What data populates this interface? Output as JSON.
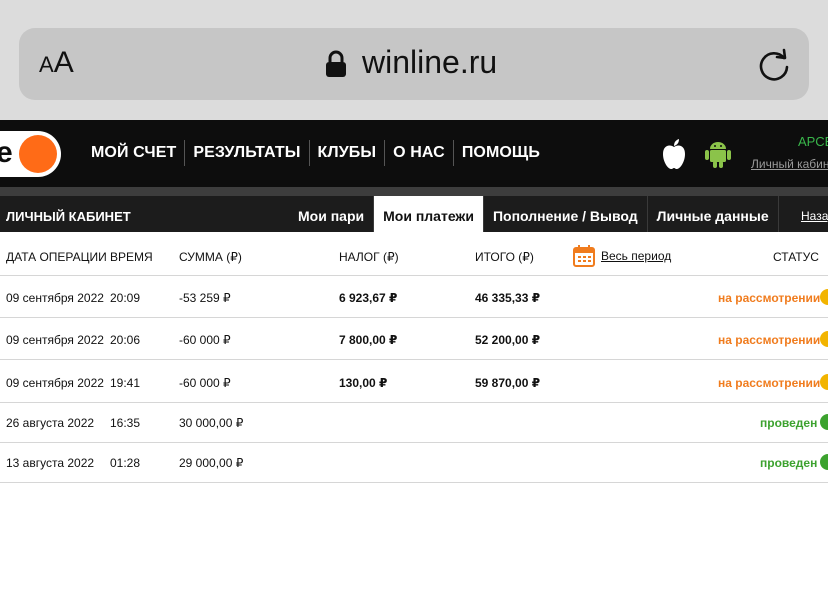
{
  "browser": {
    "aa_small": "A",
    "aa_big": "A",
    "url": "winline.ru"
  },
  "nav": {
    "logo_letter": "e",
    "menu": [
      "МОЙ СЧЕТ",
      "РЕЗУЛЬТАТЫ",
      "КЛУБЫ",
      "О НАС",
      "ПОМОЩЬ"
    ],
    "account_name": "АРСЕ",
    "account_link": "Личный кабинет"
  },
  "subnav": {
    "title": "ЛИЧНЫЙ КАБИНЕТ",
    "tabs": [
      "Мои пари",
      "Мои платежи",
      "Пополнение / Вывод",
      "Личные данные"
    ],
    "active_tab": 1,
    "back": "Назад"
  },
  "table": {
    "headers": {
      "date": "ДАТА ОПЕРАЦИИ",
      "time": "ВРЕМЯ",
      "sum": "СУММА (₽)",
      "tax": "НАЛОГ (₽)",
      "total": "ИТОГО (₽)",
      "period": "Весь период",
      "status": "СТАТУС"
    },
    "rows": [
      {
        "date": "09 сентября 2022",
        "time": "20:09",
        "sum": "-53 259 ₽",
        "tax": "6 923,67 ₽",
        "total": "46 335,33 ₽",
        "status": "на рассмотрении",
        "state": "pending"
      },
      {
        "date": "09 сентября 2022",
        "time": "20:06",
        "sum": "-60 000 ₽",
        "tax": "7 800,00 ₽",
        "total": "52 200,00 ₽",
        "status": "на рассмотрении",
        "state": "pending"
      },
      {
        "date": "09 сентября 2022",
        "time": "19:41",
        "sum": "-60 000 ₽",
        "tax": "130,00 ₽",
        "total": "59 870,00 ₽",
        "status": "на рассмотрении",
        "state": "pending"
      },
      {
        "date": "26 августа 2022",
        "time": "16:35",
        "sum": "30 000,00 ₽",
        "tax": "",
        "total": "",
        "status": "проведен",
        "state": "done"
      },
      {
        "date": "13 августа 2022",
        "time": "01:28",
        "sum": "29 000,00 ₽",
        "tax": "",
        "total": "",
        "status": "проведен",
        "state": "done"
      }
    ]
  },
  "colors": {
    "accent": "#ff6b17",
    "pending": "#f07c1e",
    "done": "#3ca22e",
    "account_green": "#39b54a"
  }
}
